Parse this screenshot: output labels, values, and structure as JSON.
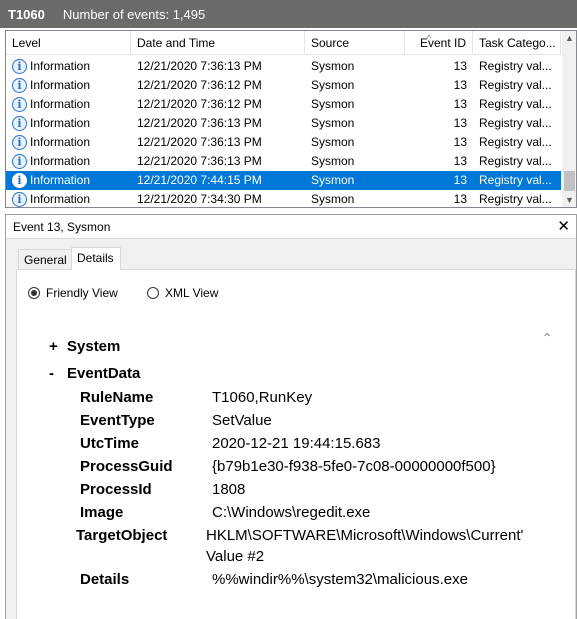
{
  "titlebar": {
    "name": "T1060",
    "count_text": "Number of events: 1,495"
  },
  "grid": {
    "columns": [
      "Level",
      "Date and Time",
      "Source",
      "Event ID",
      "Task Catego..."
    ],
    "rows": [
      {
        "level": "Information",
        "datetime": "12/21/2020 7:36:13 PM",
        "source": "Sysmon",
        "event_id": "13",
        "task": "Registry val...",
        "selected": false
      },
      {
        "level": "Information",
        "datetime": "12/21/2020 7:36:12 PM",
        "source": "Sysmon",
        "event_id": "13",
        "task": "Registry val...",
        "selected": false
      },
      {
        "level": "Information",
        "datetime": "12/21/2020 7:36:12 PM",
        "source": "Sysmon",
        "event_id": "13",
        "task": "Registry val...",
        "selected": false
      },
      {
        "level": "Information",
        "datetime": "12/21/2020 7:36:13 PM",
        "source": "Sysmon",
        "event_id": "13",
        "task": "Registry val...",
        "selected": false
      },
      {
        "level": "Information",
        "datetime": "12/21/2020 7:36:13 PM",
        "source": "Sysmon",
        "event_id": "13",
        "task": "Registry val...",
        "selected": false
      },
      {
        "level": "Information",
        "datetime": "12/21/2020 7:36:13 PM",
        "source": "Sysmon",
        "event_id": "13",
        "task": "Registry val...",
        "selected": false
      },
      {
        "level": "Information",
        "datetime": "12/21/2020 7:44:15 PM",
        "source": "Sysmon",
        "event_id": "13",
        "task": "Registry val...",
        "selected": true
      },
      {
        "level": "Information",
        "datetime": "12/21/2020 7:34:30 PM",
        "source": "Sysmon",
        "event_id": "13",
        "task": "Registry val...",
        "selected": false
      }
    ]
  },
  "details": {
    "header": "Event 13, Sysmon",
    "tabs": [
      "General",
      "Details"
    ],
    "active_tab": "Details",
    "view_options": {
      "friendly": "Friendly View",
      "xml": "XML View",
      "selected": "friendly"
    },
    "system_node": {
      "sign": "+",
      "label": "System"
    },
    "eventdata_node": {
      "sign": "-",
      "label": "EventData"
    },
    "fields": [
      {
        "name": "RuleName",
        "value": "T1060,RunKey"
      },
      {
        "name": "EventType",
        "value": "SetValue"
      },
      {
        "name": "UtcTime",
        "value": "2020-12-21 19:44:15.683"
      },
      {
        "name": "ProcessGuid",
        "value": "{b79b1e30-f938-5fe0-7c08-00000000f500}"
      },
      {
        "name": "ProcessId",
        "value": "1808"
      },
      {
        "name": "Image",
        "value": "C:\\Windows\\regedit.exe"
      },
      {
        "name": "TargetObject",
        "value": "HKLM\\SOFTWARE\\Microsoft\\Windows\\Current'",
        "value2": "Value #2"
      },
      {
        "name": "Details",
        "value": "%%windir%%\\system32\\malicious.exe"
      }
    ]
  },
  "colors": {
    "title_bg": "#6b6b6b",
    "selection": "#0078d7",
    "info_icon": "#2a6fc9"
  },
  "icons": {
    "level": "info-icon",
    "close": "close-icon"
  }
}
